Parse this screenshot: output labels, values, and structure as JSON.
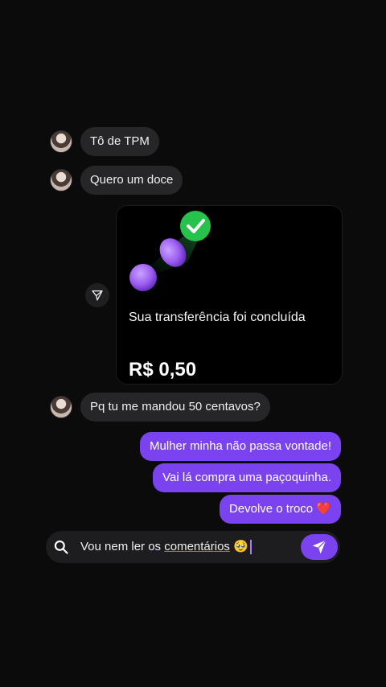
{
  "messages": {
    "incoming_1": "Tô de TPM",
    "incoming_2": "Quero um doce",
    "incoming_3": "Pq tu me mandou 50 centavos?",
    "outgoing_1": "Mulher minha não passa vontade!",
    "outgoing_2": "Vai lá compra uma paçoquinha.",
    "outgoing_3": "Devolve o troco ❤️"
  },
  "transfer_card": {
    "title": "Sua transferência foi concluída",
    "amount": "R$ 0,50"
  },
  "composer": {
    "text_before": "Vou nem ler os ",
    "text_underlined": "comentários",
    "emoji": "🥹"
  },
  "icons": {
    "avatar": "avatar",
    "share": "send-outline-icon",
    "search": "search-icon",
    "send": "send-icon",
    "check": "check-icon"
  },
  "colors": {
    "background": "#0b0b0c",
    "incoming_bubble": "#262628",
    "outgoing_bubble": "#7b43f0",
    "success": "#27c24c"
  }
}
